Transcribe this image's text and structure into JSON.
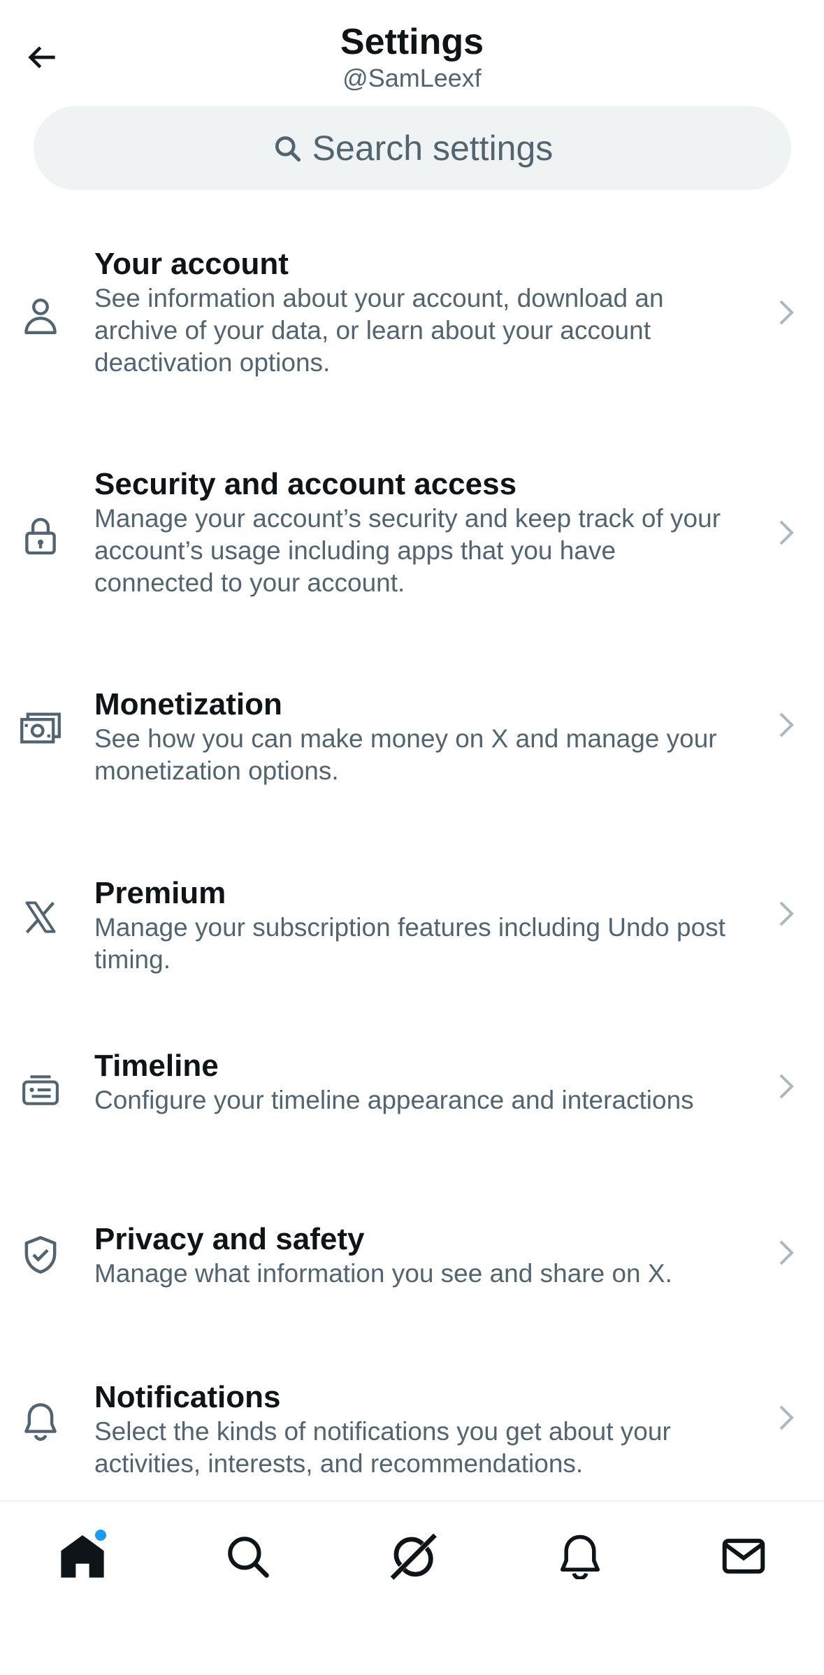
{
  "header": {
    "title": "Settings",
    "handle": "@SamLeexf"
  },
  "search": {
    "placeholder": "Search settings"
  },
  "items": [
    {
      "title": "Your account",
      "description": "See information about your account, download an archive of your data, or learn about your account deactivation options.",
      "icon": "person-icon"
    },
    {
      "title": "Security and account access",
      "description": "Manage your account’s security and keep track of your account’s usage including apps that you have connected to your account.",
      "icon": "lock-icon"
    },
    {
      "title": "Monetization",
      "description": "See how you can make money on X and manage your monetization options.",
      "icon": "money-icon"
    },
    {
      "title": "Premium",
      "description": "Manage your subscription features including Undo post timing.",
      "icon": "x-logo-icon"
    },
    {
      "title": "Timeline",
      "description": "Configure your timeline appearance and interactions",
      "icon": "timeline-icon"
    },
    {
      "title": "Privacy and safety",
      "description": "Manage what information you see and share on X.",
      "icon": "shield-icon"
    },
    {
      "title": "Notifications",
      "description": "Select the kinds of notifications you get about your activities, interests, and recommendations.",
      "icon": "bell-icon"
    }
  ],
  "bottom_nav": [
    {
      "icon": "home-icon",
      "active": true,
      "badge": true
    },
    {
      "icon": "search-icon"
    },
    {
      "icon": "grok-icon"
    },
    {
      "icon": "notifications-icon"
    },
    {
      "icon": "messages-icon"
    }
  ],
  "colors": {
    "text_primary": "#0f1419",
    "text_secondary": "#536471",
    "search_bg": "#eff3f4",
    "badge": "#1d9bf0"
  }
}
